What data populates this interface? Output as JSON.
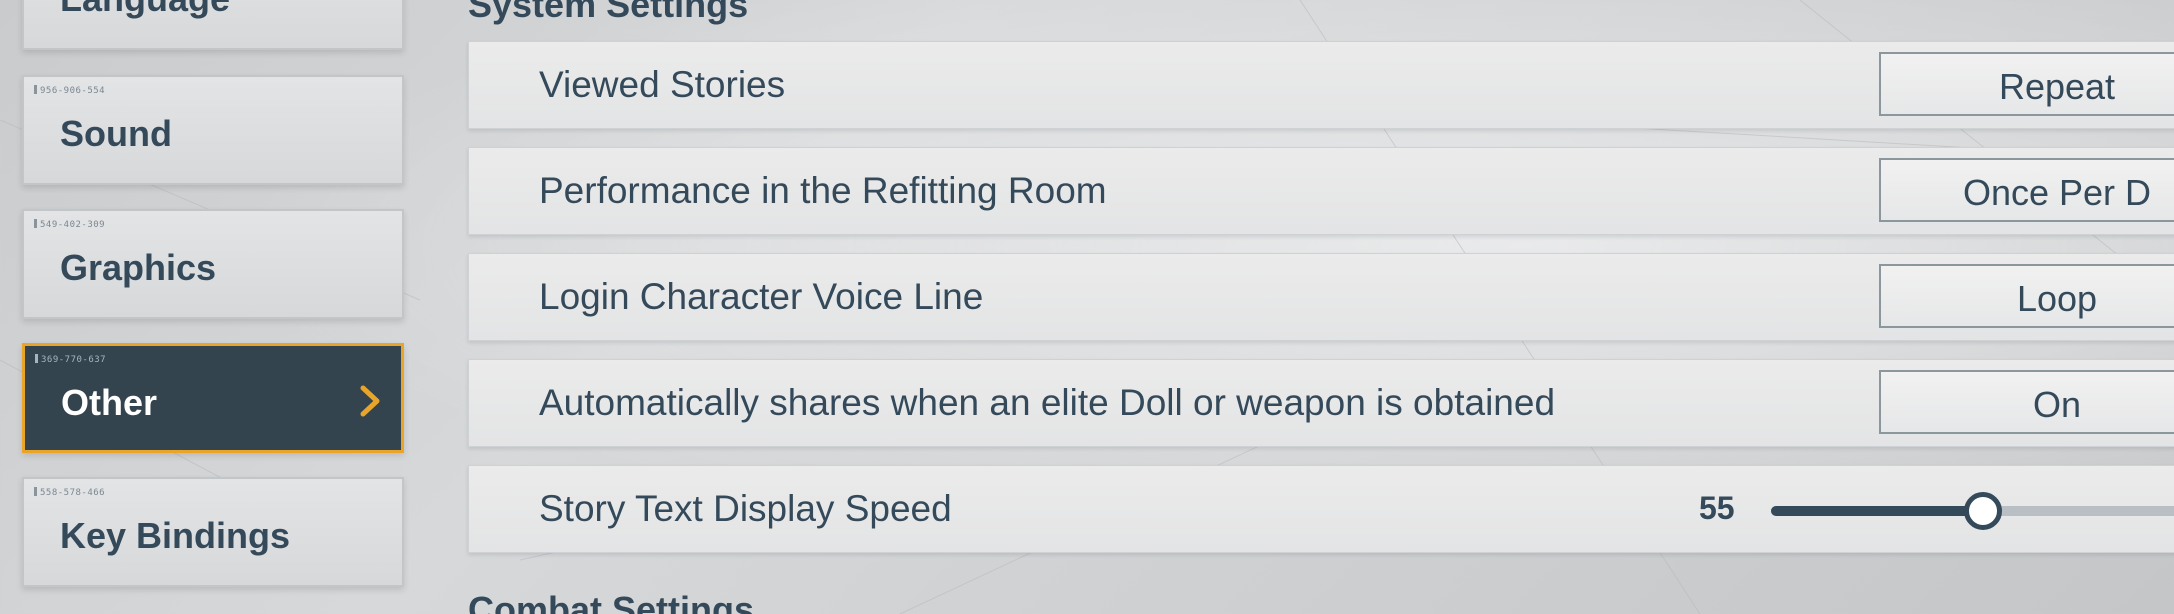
{
  "sidebar": {
    "items": [
      {
        "code": "",
        "label": "Language",
        "active": false
      },
      {
        "code": "956-906-554",
        "label": "Sound",
        "active": false
      },
      {
        "code": "549-402-309",
        "label": "Graphics",
        "active": false
      },
      {
        "code": "369-770-637",
        "label": "Other",
        "active": true
      },
      {
        "code": "558-578-466",
        "label": "Key Bindings",
        "active": false
      }
    ]
  },
  "main": {
    "system_title": "System Settings",
    "combat_title": "Combat Settings",
    "rows": [
      {
        "label": "Viewed Stories",
        "value": "Repeat"
      },
      {
        "label": "Performance in the Refitting Room",
        "value": "Once Per D"
      },
      {
        "label": "Login Character Voice Line",
        "value": "Loop"
      },
      {
        "label": "Automatically shares when an elite Doll or weapon is obtained",
        "value": "On"
      }
    ],
    "slider": {
      "label": "Story Text Display Speed",
      "value": "55",
      "fraction": 0.46
    }
  },
  "colors": {
    "accent": "#e9a52a",
    "dark": "#34495a",
    "active_bg": "#33444f"
  }
}
